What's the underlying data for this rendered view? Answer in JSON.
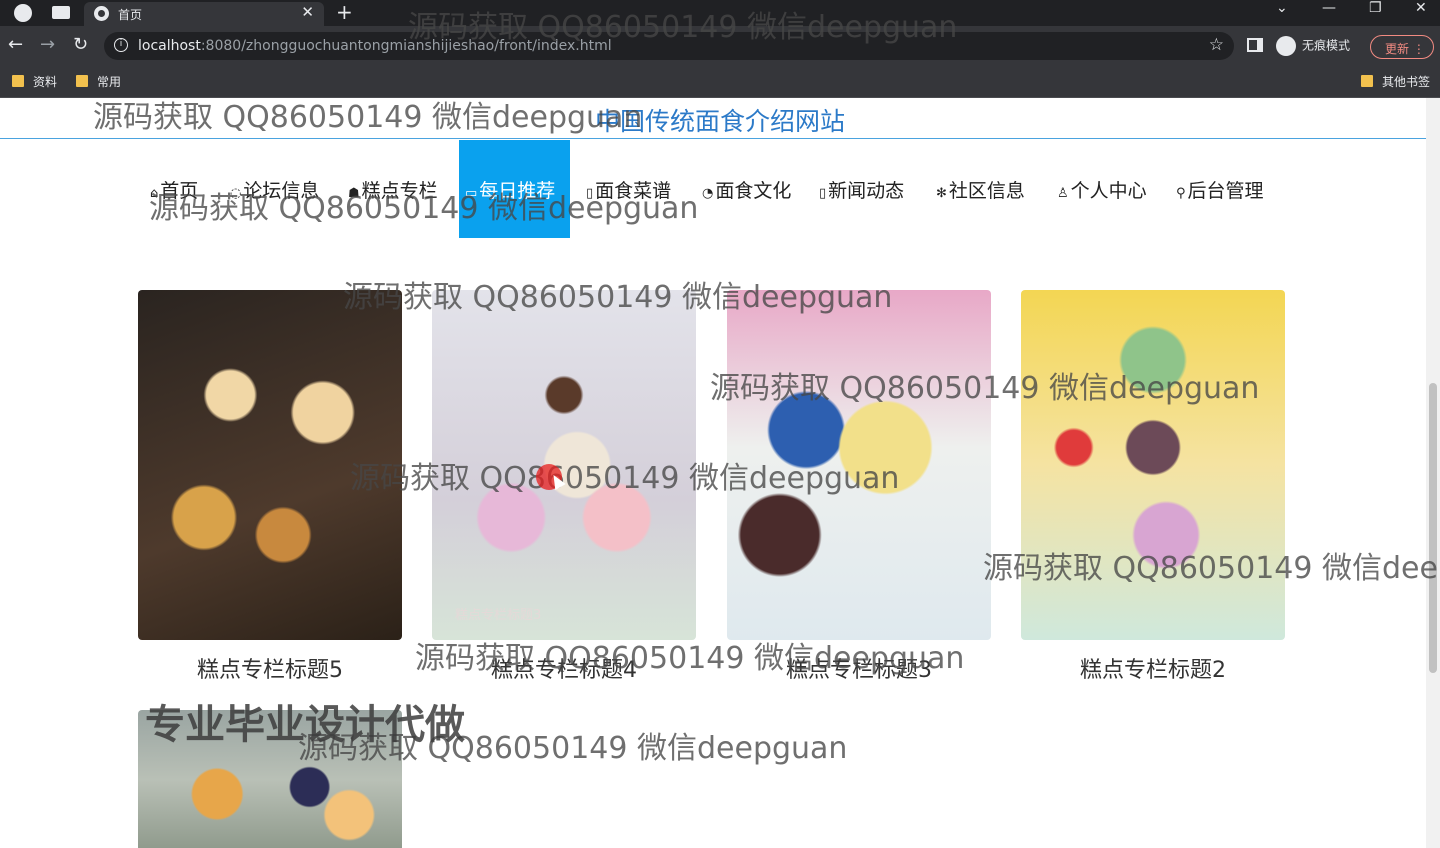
{
  "browser": {
    "tab_title": "首页",
    "tab_close": "✕",
    "new_tab": "+",
    "url_host": "localhost",
    "url_path": ":8080/zhongguochuantongmianshijieshao/front/index.html",
    "incognito_label": "无痕模式",
    "update_label": "更新",
    "bookmarks": [
      "资料",
      "常用"
    ],
    "other_bookmarks": "其他书签"
  },
  "site": {
    "title": "中国传统面食介绍网站"
  },
  "menu": [
    {
      "icon": "⌂",
      "label": "首页"
    },
    {
      "icon": "◌",
      "label": "论坛信息"
    },
    {
      "icon": "☗",
      "label": "糕点专栏"
    },
    {
      "icon": "▭",
      "label": "每日推荐"
    },
    {
      "icon": "▯",
      "label": "面食菜谱"
    },
    {
      "icon": "◔",
      "label": "面食文化"
    },
    {
      "icon": "▯",
      "label": "新闻动态"
    },
    {
      "icon": "✻",
      "label": "社区信息"
    },
    {
      "icon": "♙",
      "label": "个人中心"
    },
    {
      "icon": "⚲",
      "label": "后台管理"
    }
  ],
  "menu_active_index": 3,
  "cards": [
    {
      "caption": "糕点专栏标题5"
    },
    {
      "caption": "糕点专栏标题4"
    },
    {
      "caption": "糕点专栏标题3"
    },
    {
      "caption": "糕点专栏标题2"
    },
    {
      "caption": ""
    }
  ],
  "image_overlay_text": "糕点专栏标题3",
  "watermark_text": "源码获取 QQ86050149 微信deepguan",
  "promo_text": "专业毕业设计代做",
  "colors": {
    "accent": "#0aa1ee",
    "title": "#2c7ac8"
  }
}
